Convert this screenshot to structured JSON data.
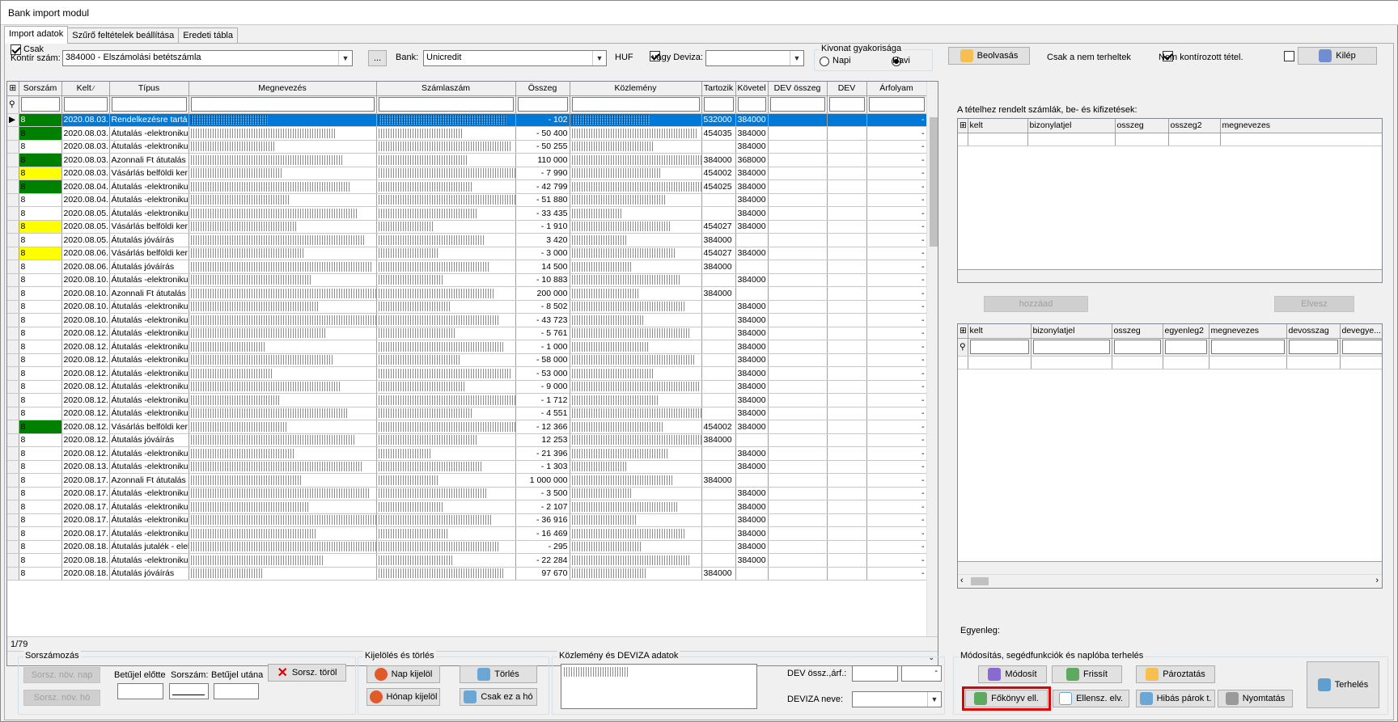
{
  "window": {
    "title": "Bank import modul"
  },
  "tabs": [
    "Import adatok",
    "Szűrő feltételek beállítása",
    "Eredeti tábla"
  ],
  "toolbar": {
    "csak_label": "Csak",
    "kontir_label": "Kontír szám:",
    "kontir_value": "384000 - Elszámolási betétszámla",
    "ellipsis": "...",
    "bank_label": "Bank:",
    "bank_value": "Unicredit",
    "huf_label": "HUF",
    "deviza_label": "vagy Deviza:",
    "deviza_value": "",
    "kivonat_title": "Kivonat gyakorisága",
    "napi": "Napi",
    "havi": "Havi",
    "beolvasas": "Beolvasás",
    "csak_nem_terheltek": "Csak a nem terheltek",
    "nem_kontirozott": "Nem kontírozott tétel.",
    "kilep": "Kilép"
  },
  "main_grid": {
    "columns": [
      "Sorszám",
      "Kelt",
      "Típus",
      "Megnevezés",
      "Számlaszám",
      "Összeg",
      "Közlemény",
      "Tartozik",
      "Követel",
      "DEV összeg",
      "DEV",
      "Árfolyam"
    ],
    "rows": [
      {
        "s": "8",
        "kelt": "2020.08.03.",
        "tipus": "Rendelkezésre tartá",
        "osszeg": "- 102",
        "tart": "532000",
        "kov": "384000",
        "arf": "-",
        "color": "green",
        "sel": true
      },
      {
        "s": "8",
        "kelt": "2020.08.03.",
        "tipus": "Átutalás -elektroniku",
        "osszeg": "- 50 400",
        "tart": "454035",
        "kov": "384000",
        "arf": "-",
        "color": "green"
      },
      {
        "s": "8",
        "kelt": "2020.08.03.",
        "tipus": "Átutalás -elektroniku",
        "osszeg": "- 50 255",
        "tart": "",
        "kov": "384000",
        "arf": "-",
        "color": ""
      },
      {
        "s": "8",
        "kelt": "2020.08.03.",
        "tipus": "Azonnali Ft átutalás",
        "osszeg": "110 000",
        "tart": "384000",
        "kov": "368000",
        "arf": "-",
        "color": "green"
      },
      {
        "s": "8",
        "kelt": "2020.08.03.",
        "tipus": "Vásárlás belföldi ker",
        "osszeg": "- 7 990",
        "tart": "454002",
        "kov": "384000",
        "arf": "-",
        "color": "yellow"
      },
      {
        "s": "8",
        "kelt": "2020.08.04.",
        "tipus": "Átutalás -elektroniku",
        "osszeg": "- 42 799",
        "tart": "454025",
        "kov": "384000",
        "arf": "-",
        "color": "green"
      },
      {
        "s": "8",
        "kelt": "2020.08.04.",
        "tipus": "Átutalás -elektroniku",
        "osszeg": "- 51 880",
        "tart": "",
        "kov": "384000",
        "arf": "-",
        "color": ""
      },
      {
        "s": "8",
        "kelt": "2020.08.05.",
        "tipus": "Átutalás -elektroniku",
        "osszeg": "- 33 435",
        "tart": "",
        "kov": "384000",
        "arf": "-",
        "color": ""
      },
      {
        "s": "8",
        "kelt": "2020.08.05.",
        "tipus": "Vásárlás belföldi ker",
        "osszeg": "- 1 910",
        "tart": "454027",
        "kov": "384000",
        "arf": "-",
        "color": "yellow"
      },
      {
        "s": "8",
        "kelt": "2020.08.05.",
        "tipus": "Átutalás jóváírás",
        "osszeg": "3 420",
        "tart": "384000",
        "kov": "",
        "arf": "-",
        "color": ""
      },
      {
        "s": "8",
        "kelt": "2020.08.06.",
        "tipus": "Vásárlás belföldi ker",
        "osszeg": "- 3 000",
        "tart": "454027",
        "kov": "384000",
        "arf": "-",
        "color": "yellow"
      },
      {
        "s": "8",
        "kelt": "2020.08.06.",
        "tipus": "Átutalás jóváírás",
        "osszeg": "14 500",
        "tart": "384000",
        "kov": "",
        "arf": "-",
        "color": ""
      },
      {
        "s": "8",
        "kelt": "2020.08.10.",
        "tipus": "Átutalás -elektroniku",
        "osszeg": "- 10 883",
        "tart": "",
        "kov": "384000",
        "arf": "-",
        "color": ""
      },
      {
        "s": "8",
        "kelt": "2020.08.10.",
        "tipus": "Azonnali Ft átutalás",
        "osszeg": "200 000",
        "tart": "384000",
        "kov": "",
        "arf": "-",
        "color": ""
      },
      {
        "s": "8",
        "kelt": "2020.08.10.",
        "tipus": "Átutalás -elektroniku",
        "osszeg": "- 8 502",
        "tart": "",
        "kov": "384000",
        "arf": "-",
        "color": ""
      },
      {
        "s": "8",
        "kelt": "2020.08.10.",
        "tipus": "Átutalás -elektroniku",
        "osszeg": "- 43 723",
        "tart": "",
        "kov": "384000",
        "arf": "-",
        "color": ""
      },
      {
        "s": "8",
        "kelt": "2020.08.12.",
        "tipus": "Átutalás -elektroniku",
        "osszeg": "- 5 761",
        "tart": "",
        "kov": "384000",
        "arf": "-",
        "color": ""
      },
      {
        "s": "8",
        "kelt": "2020.08.12.",
        "tipus": "Átutalás -elektroniku",
        "osszeg": "- 1 000",
        "tart": "",
        "kov": "384000",
        "arf": "-",
        "color": ""
      },
      {
        "s": "8",
        "kelt": "2020.08.12.",
        "tipus": "Átutalás -elektroniku",
        "osszeg": "- 58 000",
        "tart": "",
        "kov": "384000",
        "arf": "-",
        "color": ""
      },
      {
        "s": "8",
        "kelt": "2020.08.12.",
        "tipus": "Átutalás -elektroniku",
        "osszeg": "- 53 000",
        "tart": "",
        "kov": "384000",
        "arf": "-",
        "color": ""
      },
      {
        "s": "8",
        "kelt": "2020.08.12.",
        "tipus": "Átutalás -elektroniku",
        "osszeg": "- 9 000",
        "tart": "",
        "kov": "384000",
        "arf": "-",
        "color": ""
      },
      {
        "s": "8",
        "kelt": "2020.08.12.",
        "tipus": "Átutalás -elektroniku",
        "osszeg": "- 1 712",
        "tart": "",
        "kov": "384000",
        "arf": "-",
        "color": ""
      },
      {
        "s": "8",
        "kelt": "2020.08.12.",
        "tipus": "Átutalás -elektroniku",
        "osszeg": "- 4 551",
        "tart": "",
        "kov": "384000",
        "arf": "-",
        "color": ""
      },
      {
        "s": "8",
        "kelt": "2020.08.12.",
        "tipus": "Vásárlás belföldi ker",
        "osszeg": "- 12 366",
        "tart": "454002",
        "kov": "384000",
        "arf": "-",
        "color": "green"
      },
      {
        "s": "8",
        "kelt": "2020.08.12.",
        "tipus": "Átutalás jóváírás",
        "osszeg": "12 253",
        "tart": "384000",
        "kov": "",
        "arf": "-",
        "color": ""
      },
      {
        "s": "8",
        "kelt": "2020.08.12.",
        "tipus": "Átutalás -elektroniku",
        "osszeg": "- 21 396",
        "tart": "",
        "kov": "384000",
        "arf": "-",
        "color": ""
      },
      {
        "s": "8",
        "kelt": "2020.08.13.",
        "tipus": "Átutalás -elektroniku",
        "osszeg": "- 1 303",
        "tart": "",
        "kov": "384000",
        "arf": "-",
        "color": ""
      },
      {
        "s": "8",
        "kelt": "2020.08.17.",
        "tipus": "Azonnali Ft átutalás",
        "osszeg": "1 000 000",
        "tart": "384000",
        "kov": "",
        "arf": "-",
        "color": ""
      },
      {
        "s": "8",
        "kelt": "2020.08.17.",
        "tipus": "Átutalás -elektroniku",
        "osszeg": "- 3 500",
        "tart": "",
        "kov": "384000",
        "arf": "-",
        "color": ""
      },
      {
        "s": "8",
        "kelt": "2020.08.17.",
        "tipus": "Átutalás -elektroniku",
        "osszeg": "- 2 107",
        "tart": "",
        "kov": "384000",
        "arf": "-",
        "color": ""
      },
      {
        "s": "8",
        "kelt": "2020.08.17.",
        "tipus": "Átutalás -elektroniku",
        "osszeg": "- 36 916",
        "tart": "",
        "kov": "384000",
        "arf": "-",
        "color": ""
      },
      {
        "s": "8",
        "kelt": "2020.08.17.",
        "tipus": "Átutalás -elektroniku",
        "osszeg": "- 16 469",
        "tart": "",
        "kov": "384000",
        "arf": "-",
        "color": ""
      },
      {
        "s": "8",
        "kelt": "2020.08.18.",
        "tipus": "Átutalás jutalék - elel",
        "osszeg": "- 295",
        "tart": "",
        "kov": "384000",
        "arf": "-",
        "color": ""
      },
      {
        "s": "8",
        "kelt": "2020.08.18.",
        "tipus": "Átutalás -elektroniku",
        "osszeg": "- 22 284",
        "tart": "",
        "kov": "384000",
        "arf": "-",
        "color": ""
      },
      {
        "s": "8",
        "kelt": "2020.08.18.",
        "tipus": "Átutalás jóváírás",
        "osszeg": "97 670",
        "tart": "384000",
        "kov": "",
        "arf": "-",
        "color": ""
      }
    ],
    "record_count": "1/79"
  },
  "right_panel": {
    "title": "A tételhez rendelt számlák, be- és kifizetések:",
    "top_columns": [
      "kelt",
      "bizonylatjel",
      "osszeg",
      "osszeg2",
      "megnevezes"
    ],
    "hozzaad": "hozzáad",
    "elvesz": "Elvesz",
    "bottom_columns": [
      "kelt",
      "bizonylatjel",
      "osszeg",
      "egyenleg2",
      "megnevezes",
      "devosszag",
      "devegye..."
    ],
    "egyenleg": "Egyenleg:"
  },
  "sorszamozas": {
    "title": "Sorszámozás",
    "btn1": "Sorsz. növ. nap",
    "btn2": "Sorsz. növ. hó",
    "betujel_elotte": "Betűjel előtte",
    "sorszam": "Sorszám:",
    "betujel_utana": "Betűjel utána",
    "sorsz_torol": "Sorsz. töröl"
  },
  "kijeloles": {
    "title": "Kijelölés és törlés",
    "nap_kijelol": "Nap kijelöl",
    "torles": "Törlés",
    "honap_kijelol": "Hónap kijelöl",
    "csak_ez_a_ho": "Csak ez a hó"
  },
  "kozlemeny": {
    "title": "Közlemény és DEVIZA adatok",
    "dev_ossz": "DEV össz.,árf.:",
    "dev_arf": "-",
    "deviza_neve": "DEVIZA neve:"
  },
  "modositas": {
    "title": "Módosítás, segédfunkciók és naplóba terhelés",
    "modosit": "Módosít",
    "frissit": "Frissít",
    "paroztatas": "Pároztatás",
    "fokonyv": "Főkönyv ell.",
    "ellensz": "Ellensz. elv.",
    "hibas": "Hibás párok t.",
    "nyomtatas": "Nyomtatás",
    "terheles": "Terhelés"
  },
  "colors": {
    "green": "#008000",
    "yellow": "#ffff00",
    "selection": "#0078d7",
    "highlight_box": "#e00000"
  }
}
